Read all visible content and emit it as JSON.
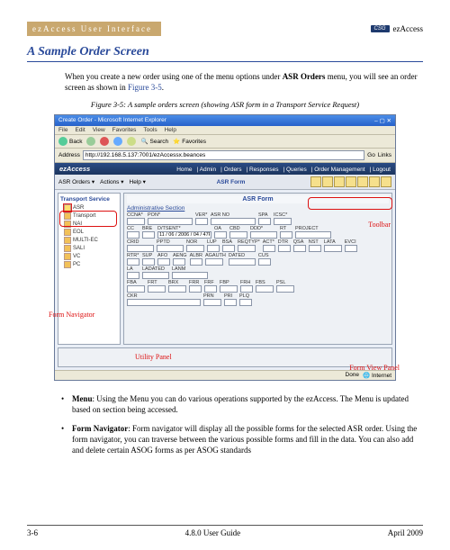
{
  "header": {
    "breadcrumb": "ezAccess User Interface",
    "product": "ezAccess",
    "logo": "CSG"
  },
  "section": {
    "title": "A Sample Order Screen"
  },
  "intro": {
    "text_before": "When you create a new order using one of the menu options under ",
    "bold": "ASR Orders",
    "text_after": " menu, you will see an order screen as shown in ",
    "link": "Figure 3-5",
    "period": "."
  },
  "caption": "Figure 3-5:  A sample orders screen (showing ASR form in a Transport Service Request)",
  "window": {
    "title": "Create Order - Microsoft Internet Explorer",
    "menu": [
      "File",
      "Edit",
      "View",
      "Favorites",
      "Tools",
      "Help"
    ],
    "toolbar": {
      "back": "Back",
      "search": "Search",
      "favorites": "Favorites"
    },
    "address_label": "Address",
    "address_value": "http://192.168.5.137:7001/ezAccessx.beances",
    "go": "Go",
    "links": "Links"
  },
  "app": {
    "brand": "ezAccess",
    "nav": [
      "Home",
      "Admin",
      "Orders",
      "Responses",
      "Queries",
      "Order Management",
      "Logout"
    ],
    "subbar": [
      "ASR Orders",
      "Actions",
      "Help"
    ],
    "form_tab": "ASR Form",
    "tree_title": "Transport Service",
    "tree_items": [
      "ASR",
      "Transport",
      "NAI",
      "EOL",
      "MULTI-EC",
      "SALI",
      "VC",
      "PC"
    ],
    "section1": "Administrative Section",
    "row1": [
      {
        "l": "CCNA*",
        "w": "w16"
      },
      {
        "l": "PON*",
        "w": "w40"
      },
      {
        "l": "VER*",
        "w": "w10"
      },
      {
        "l": "ASR NO",
        "w": "w40"
      },
      {
        "l": "SPA",
        "w": "w10"
      },
      {
        "l": "ICSC*",
        "w": "w16"
      }
    ],
    "row2": [
      {
        "l": "CC",
        "w": "w10"
      },
      {
        "l": "BRE",
        "w": "w10"
      },
      {
        "l": "D/TSENT*",
        "w": "w50",
        "v": "11 / 06 / 2006 / 04 / 47PM"
      },
      {
        "l": "OA",
        "w": "w10"
      },
      {
        "l": "CBD",
        "w": "w16"
      },
      {
        "l": "DDD*",
        "w": "w24"
      },
      {
        "l": "RT",
        "w": "w10"
      },
      {
        "l": "PROJECT",
        "w": "w32"
      }
    ],
    "row3": [
      {
        "l": "CRID",
        "w": "w24"
      },
      {
        "l": "PPTD",
        "w": "w24"
      },
      {
        "l": "NOR",
        "w": "w16"
      },
      {
        "l": "LUP",
        "w": "w10"
      },
      {
        "l": "BSA",
        "w": "w10"
      },
      {
        "l": "REQTYP*",
        "w": "w16"
      },
      {
        "l": "ACT*",
        "w": "w10"
      },
      {
        "l": "DTR",
        "w": "w10"
      },
      {
        "l": "QSA",
        "w": "w10"
      },
      {
        "l": "NST",
        "w": "w10"
      },
      {
        "l": "LATA",
        "w": "w16"
      },
      {
        "l": "EVCI",
        "w": "w10"
      }
    ],
    "row4": [
      {
        "l": "RTR*",
        "w": "w10"
      },
      {
        "l": "SUP",
        "w": "w10"
      },
      {
        "l": "AFO",
        "w": "w10"
      },
      {
        "l": "AENG",
        "w": "w10"
      },
      {
        "l": "ALBR",
        "w": "w10"
      },
      {
        "l": "AGAUTH",
        "w": "w16"
      },
      {
        "l": "DATED",
        "w": "w24"
      },
      {
        "l": "CUS",
        "w": "w10"
      }
    ],
    "row5": [
      {
        "l": "LA",
        "w": "w10"
      },
      {
        "l": "LADATED",
        "w": "w24"
      },
      {
        "l": "LANM",
        "w": "w32"
      }
    ],
    "row6": [
      {
        "l": "FBA",
        "w": "w16"
      },
      {
        "l": "FRT",
        "w": "w16"
      },
      {
        "l": "BRX",
        "w": "w16"
      },
      {
        "l": "FRR",
        "w": "w10"
      },
      {
        "l": "FRF",
        "w": "w10"
      },
      {
        "l": "FBP",
        "w": "w16"
      },
      {
        "l": "FRH",
        "w": "w10"
      },
      {
        "l": "FBS",
        "w": "w16"
      },
      {
        "l": "PSL",
        "w": "w16"
      }
    ],
    "row7": [
      {
        "l": "CKR",
        "w": "w70"
      },
      {
        "l": "PRN",
        "w": "w16"
      },
      {
        "l": "PRI",
        "w": "w10"
      },
      {
        "l": "PLQ",
        "w": "w10"
      }
    ],
    "status": {
      "done": "Done",
      "zone": "Internet"
    }
  },
  "callouts": {
    "toolbar": "Toolbar",
    "form_nav": "Form Navigator",
    "form_view": "Form View Panel",
    "utility": "Utility Panel"
  },
  "bullets": [
    {
      "term": "Menu",
      "text": ": Using the Menu you can do various operations supported by the ezAccess. The Menu is updated based on section being accessed."
    },
    {
      "term": "Form Navigator",
      "text": ": Form navigator will display all the possible forms for the selected ASR order. Using the form navigator, you can traverse between the various possible forms and fill in the data. You can also add and delete certain ASOG forms as per ASOG standards"
    }
  ],
  "footer": {
    "left": "3-6",
    "center": "4.8.0 User Guide",
    "right": "April 2009"
  }
}
